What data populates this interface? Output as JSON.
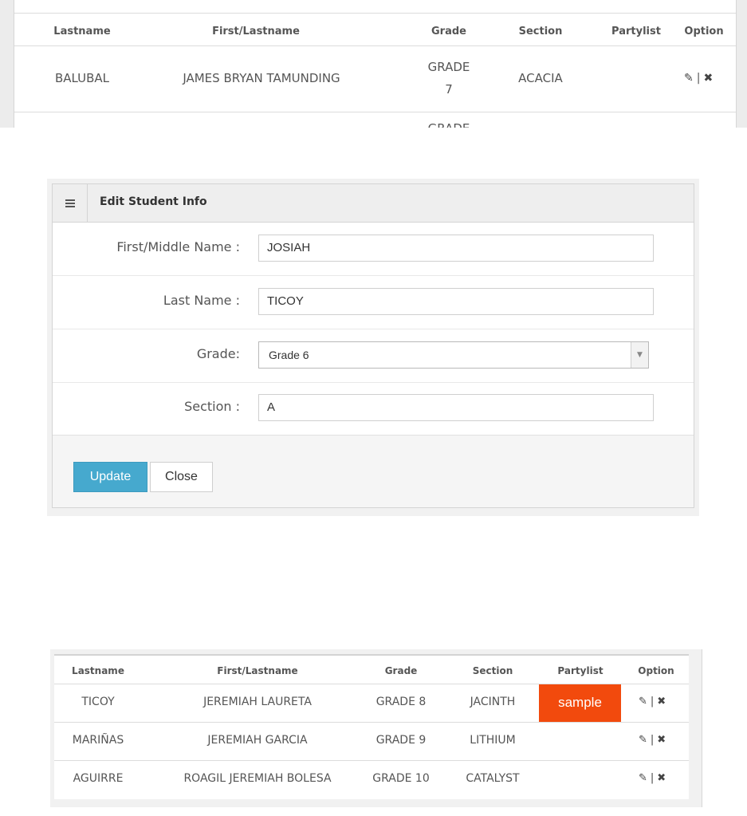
{
  "top_table": {
    "headers": [
      "Lastname",
      "First/Lastname",
      "Grade",
      "Section",
      "Partylist",
      "Option"
    ],
    "row": {
      "lastname": "BALUBAL",
      "first_lastname": "JAMES BRYAN TAMUNDING",
      "grade_line1": "GRADE",
      "grade_line2": "7",
      "section": "ACACIA",
      "partylist": ""
    },
    "next_row_partial": "GRADE"
  },
  "edit_panel": {
    "title": "Edit Student Info",
    "fields": {
      "first_middle": {
        "label": "First/Middle Name :",
        "value": "JOSIAH"
      },
      "last": {
        "label": "Last Name :",
        "value": "TICOY"
      },
      "grade": {
        "label": "Grade:",
        "value": "Grade 6"
      },
      "section": {
        "label": "Section :",
        "value": "A"
      }
    },
    "buttons": {
      "update": "Update",
      "close": "Close"
    }
  },
  "bottom_table": {
    "headers": [
      "Lastname",
      "First/Lastname",
      "Grade",
      "Section",
      "Partylist",
      "Option"
    ],
    "rows": [
      {
        "lastname": "TICOY",
        "first_lastname": "JEREMIAH LAURETA",
        "grade": "GRADE 8",
        "section": "JACINTH",
        "partylist": "sample"
      },
      {
        "lastname": "MARIÑAS",
        "first_lastname": "JEREMIAH GARCIA",
        "grade": "GRADE 9",
        "section": "LITHIUM",
        "partylist": ""
      },
      {
        "lastname": "AGUIRRE",
        "first_lastname": "ROAGIL JEREMIAH BOLESA",
        "grade": "GRADE 10",
        "section": "CATALYST",
        "partylist": ""
      }
    ]
  },
  "icons": {
    "edit": "pencil-icon",
    "delete": "close-x-icon",
    "menu": "hamburger-icon"
  },
  "option_separator": "|",
  "colors": {
    "update_button": "#46a9ce",
    "partylist_badge": "#f24a0d"
  }
}
